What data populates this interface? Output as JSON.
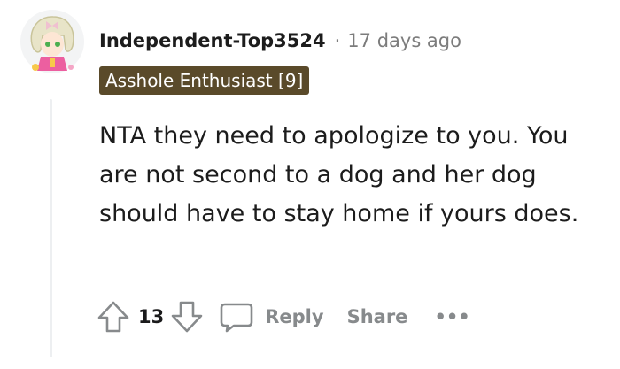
{
  "comment": {
    "username": "Independent-Top3524",
    "separator": "·",
    "timestamp": "17 days ago",
    "flair": "Asshole Enthusiast [9]",
    "body": "NTA they need to apologize to you. You are not second to a dog and her dog should have to stay home if yours does.",
    "vote_count": "13",
    "reply_label": "Reply",
    "share_label": "Share",
    "more_label": "•••"
  },
  "colors": {
    "flair_background": "#5a4a2a",
    "muted_text": "#878a8c",
    "thread_line": "#edeff1"
  },
  "icons": {
    "avatar": "anime-avatar-icon",
    "upvote": "upvote-arrow-icon",
    "downvote": "downvote-arrow-icon",
    "reply": "speech-bubble-icon",
    "more": "ellipsis-icon"
  }
}
